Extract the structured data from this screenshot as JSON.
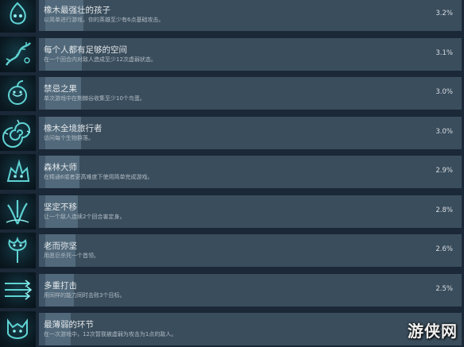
{
  "achievements": [
    {
      "title": "橡木最强壮的孩子",
      "desc": "以简单进行游戏，你的英雄至少有6点基础攻击。",
      "percent": "3.2%",
      "percent_value": 3.2,
      "icon": "flame-spirit-icon"
    },
    {
      "title": "每个人都有足够的空间",
      "desc": "在一个回合内对敌人造成至少12次虚弱状态。",
      "percent": "3.1%",
      "percent_value": 3.1,
      "icon": "bramble-icon"
    },
    {
      "title": "禁忌之果",
      "desc": "单次游戏中在荆棘谷收集至少10个鸟蛋。",
      "percent": "3.0%",
      "percent_value": 3.0,
      "icon": "forbidden-fruit-icon"
    },
    {
      "title": "橡木全境旅行者",
      "desc": "访问每个生物群落。",
      "percent": "3.0%",
      "percent_value": 3.0,
      "icon": "spiral-wind-icon"
    },
    {
      "title": "森林大师",
      "desc": "在精通6或者更高难度下使用简单完成游戏。",
      "percent": "2.9%",
      "percent_value": 2.9,
      "icon": "beast-icon"
    },
    {
      "title": "坚定不移",
      "desc": "让一个敌人连续2个回合害定身。",
      "percent": "2.8%",
      "percent_value": 2.8,
      "icon": "root-claw-icon"
    },
    {
      "title": "老而弥坚",
      "desc": "用愿巨杀死一个首领。",
      "percent": "2.6%",
      "percent_value": 2.6,
      "icon": "old-tree-icon"
    },
    {
      "title": "多重打击",
      "desc": "用同样的能力同时击败3个目标。",
      "percent": "2.5%",
      "percent_value": 2.5,
      "icon": "arrows-icon"
    },
    {
      "title": "最薄弱的环节",
      "desc": "在一次游戏中，12次暂我被虚弱为攻击为1点的敌人。",
      "percent": "2.3%",
      "percent_value": 2.3,
      "icon": "fox-spirit-icon"
    }
  ],
  "watermark": "游侠网",
  "colors": {
    "background": "#1b2838",
    "bar": "#3a4d5c",
    "bar_fill": "#51697a",
    "icon_glow": "#5fd3d3"
  }
}
